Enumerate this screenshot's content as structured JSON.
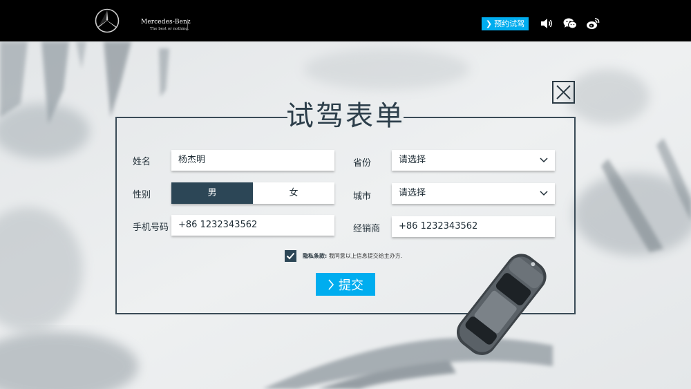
{
  "header": {
    "brand_name": "Mercedes-Benz",
    "brand_tagline": "The best or nothing.",
    "book_test_drive_label": "预约试驾",
    "icons": [
      "mercedes-star-logo",
      "sound-icon",
      "wechat-icon",
      "weibo-icon"
    ]
  },
  "form": {
    "title": "试驾表单",
    "name_label": "姓名",
    "name_value": "杨杰明",
    "gender_label": "性别",
    "gender_male": "男",
    "gender_female": "女",
    "gender_selected": "男",
    "phone_label": "手机号码",
    "phone_value": "+86  1232343562",
    "province_label": "省份",
    "province_value": "请选择",
    "city_label": "城市",
    "city_value": "请选择",
    "dealer_label": "经销商",
    "dealer_value": "+86  1232343562",
    "privacy_bold": "隐私条款:",
    "privacy_text": " 我同意以上信息提交给主办方.",
    "privacy_checked": true,
    "submit_label": "提交"
  },
  "colors": {
    "accent": "#00adef",
    "dark_teal": "#2c4656",
    "topbar": "#000000"
  }
}
